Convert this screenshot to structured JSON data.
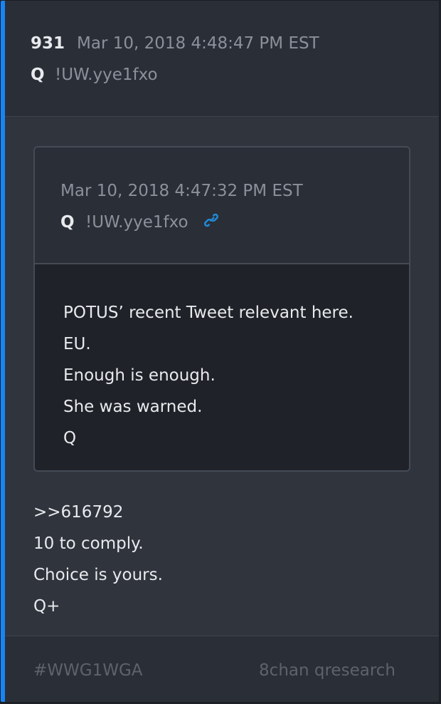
{
  "post": {
    "number": "931",
    "date": "Mar 10, 2018 4:48:47 PM EST",
    "author": "Q",
    "tripcode": "!UW.yye1fxo"
  },
  "quoted_post": {
    "date": "Mar 10, 2018 4:47:32 PM EST",
    "author": "Q",
    "tripcode": "!UW.yye1fxo",
    "icon": "link-icon",
    "lines": [
      "POTUS’ recent Tweet relevant here.",
      "EU.",
      "Enough is enough.",
      "She was warned.",
      "Q"
    ]
  },
  "body": {
    "lines": [
      ">>616792",
      "10 to comply.",
      "Choice is yours.",
      "Q+"
    ]
  },
  "footer": {
    "hashtag": "#WWG1WGA",
    "source": "8chan qresearch"
  },
  "colors": {
    "accent": "#1784f5",
    "link_icon": "#1f8ad6",
    "background": "#2f343d"
  }
}
